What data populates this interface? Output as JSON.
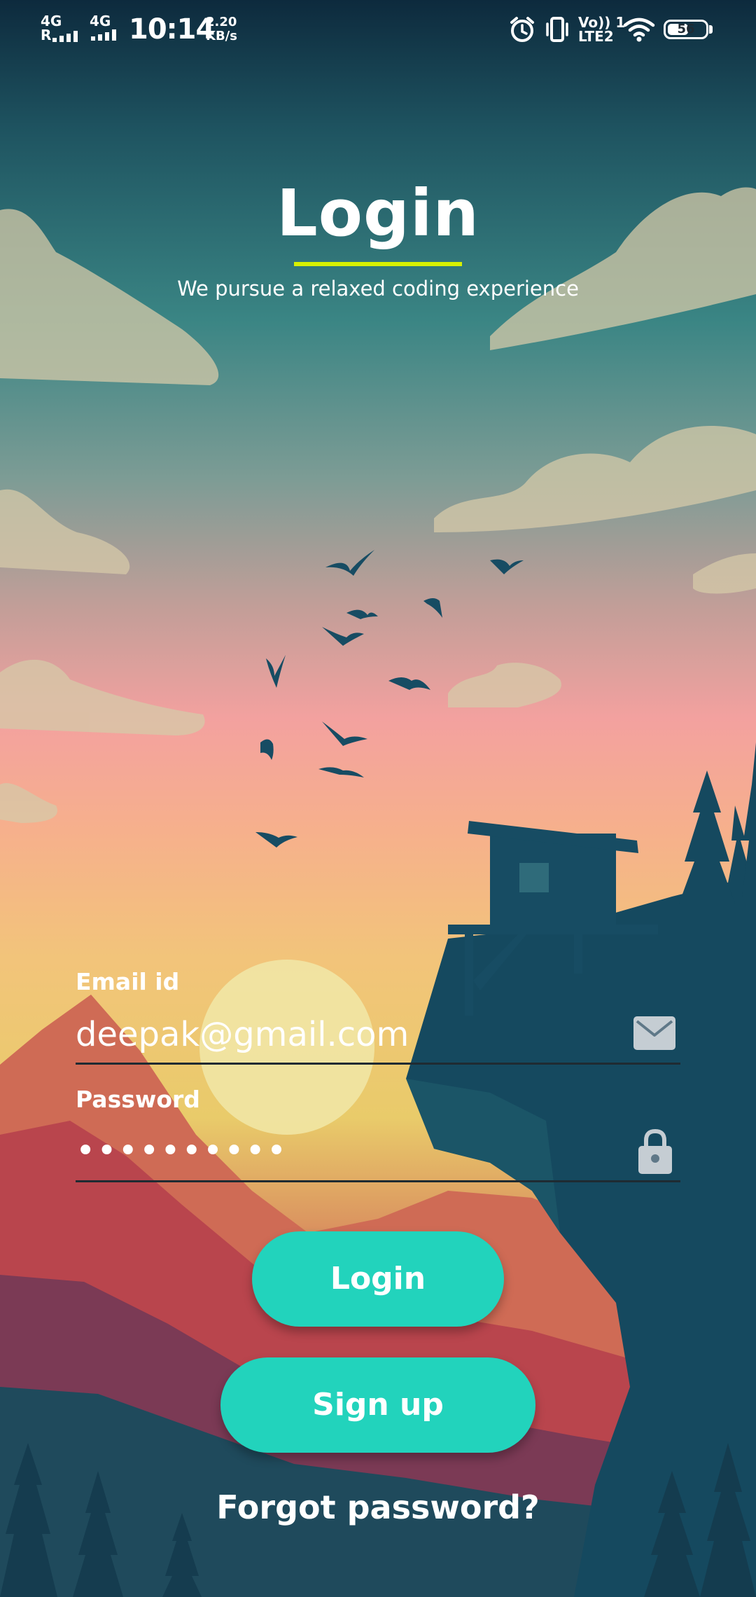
{
  "status_bar": {
    "sim1": {
      "network": "4G",
      "roaming": "R"
    },
    "sim2": {
      "network": "4G"
    },
    "time": "10:14",
    "speed_value": "2.20",
    "speed_unit": "KB/s",
    "volte_top": "Vo)) 1",
    "volte_bottom": "LTE2",
    "battery_percent": "56",
    "battery_level": 0.56,
    "icons": [
      "signal-bars",
      "alarm-clock",
      "vibrate",
      "wifi",
      "battery"
    ]
  },
  "header": {
    "title": "Login",
    "subtitle": "We pursue a relaxed coding experience",
    "underline_color": "#d7f100"
  },
  "form": {
    "email": {
      "label": "Email id",
      "value": "deepak@gmail.com",
      "icon": "envelope"
    },
    "password": {
      "label": "Password",
      "value": "••••••••••",
      "icon": "lock"
    }
  },
  "buttons": {
    "login_label": "Login",
    "signup_label": "Sign up",
    "forgot_label": "Forgot password?",
    "accent_color": "#22d3bc"
  }
}
